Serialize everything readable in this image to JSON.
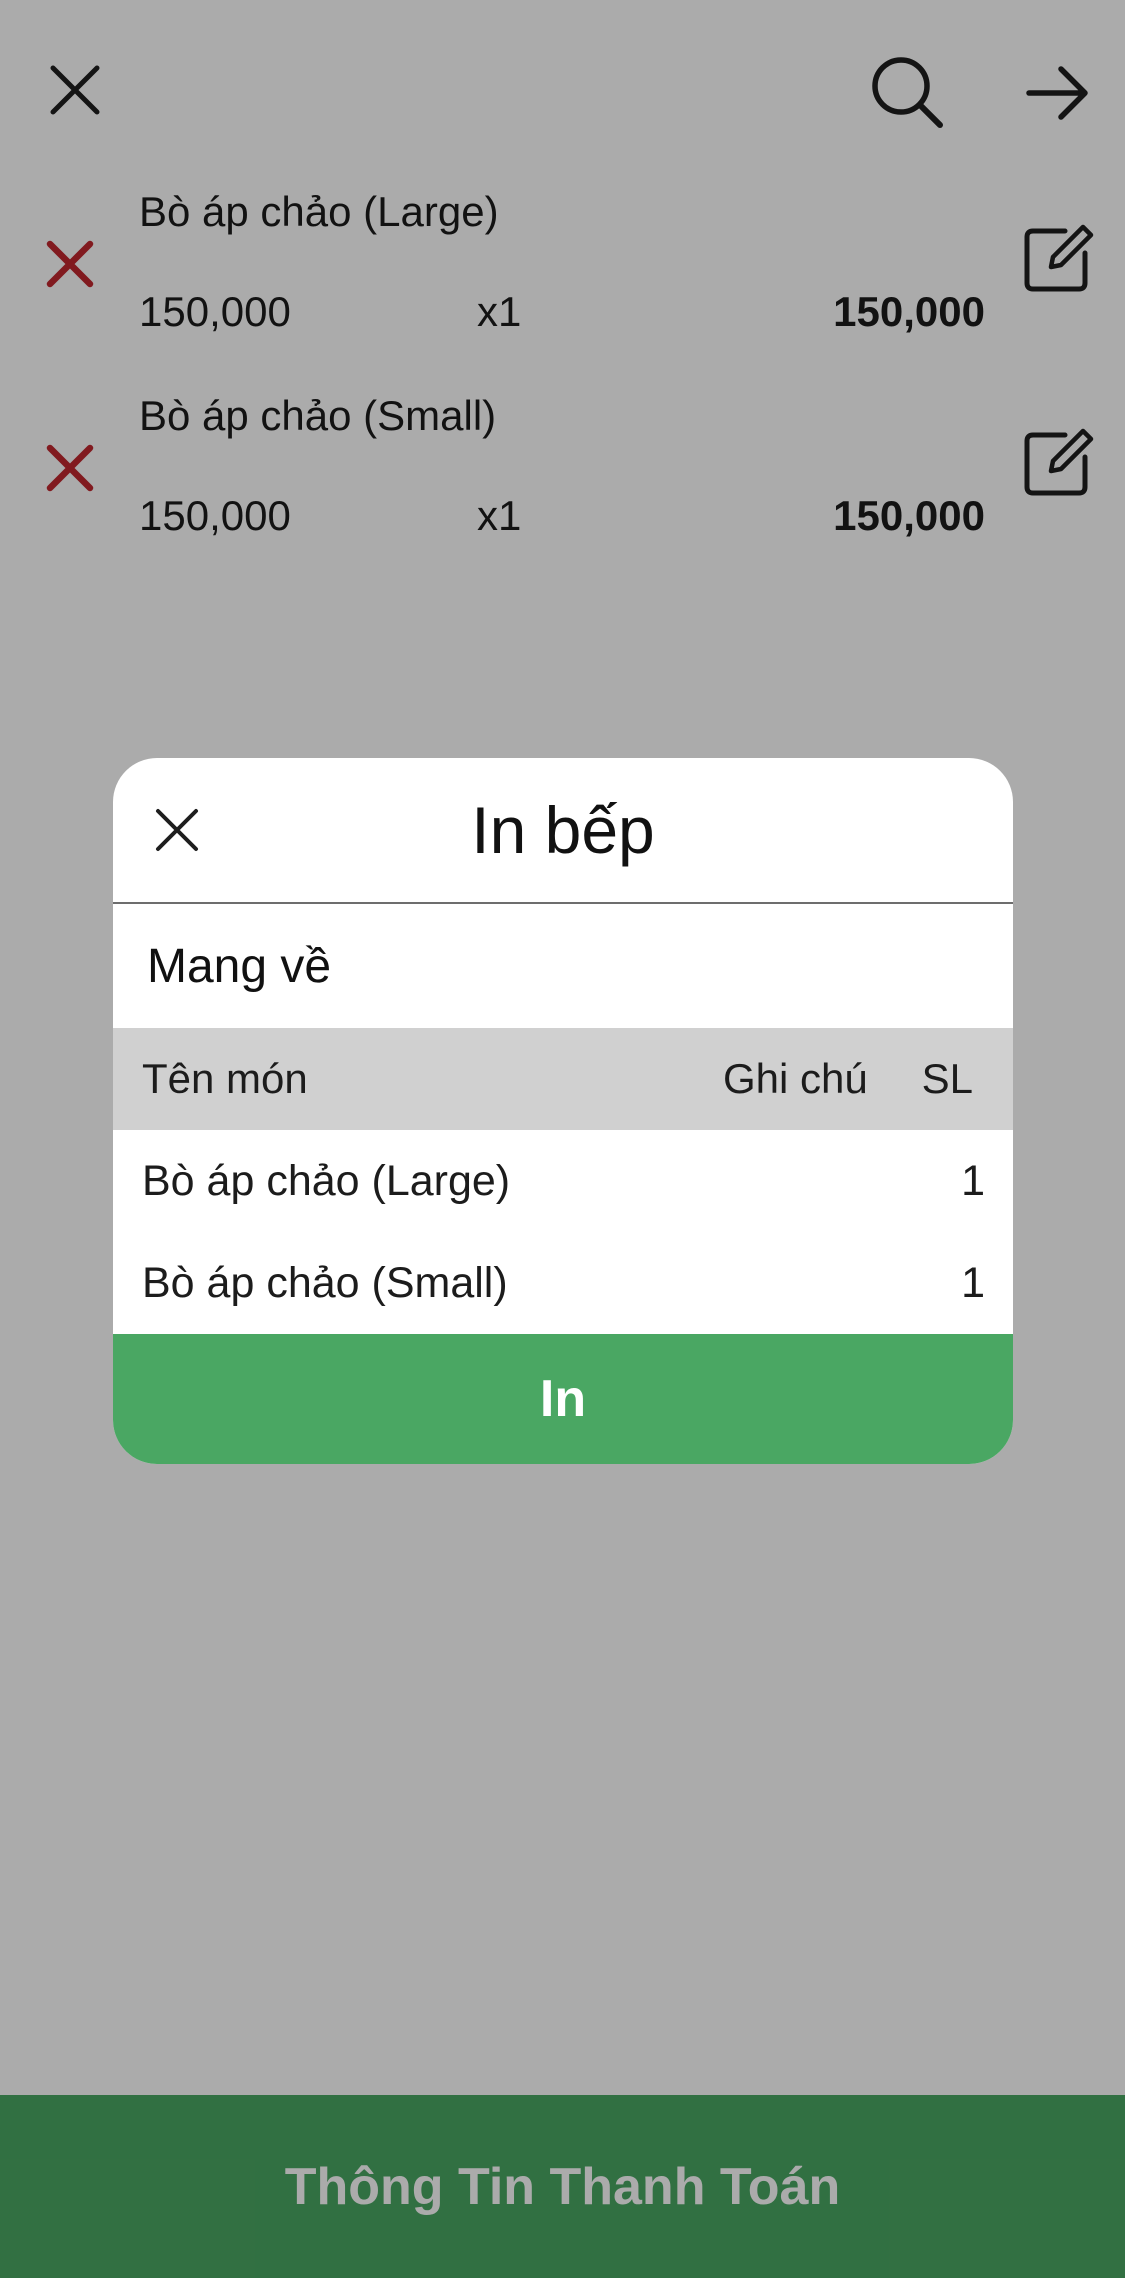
{
  "colors": {
    "accent_green": "#4aa763",
    "delete_red": "#c0272f",
    "overlay": "rgba(0,0,0,0.33)",
    "table_header_bg": "#d0d0d0"
  },
  "topbar": {
    "close_icon": "close-icon",
    "search_icon": "search-icon",
    "next_icon": "arrow-right-icon"
  },
  "order_items": [
    {
      "name": "Bò áp chảo (Large)",
      "unit_price": "150,000",
      "quantity": "x1",
      "total": "150,000"
    },
    {
      "name": "Bò áp chảo (Small)",
      "unit_price": "150,000",
      "quantity": "x1",
      "total": "150,000"
    }
  ],
  "payment_bar": {
    "label": "Thông Tin Thanh Toán"
  },
  "modal": {
    "title": "In bếp",
    "order_type": "Mang về",
    "table": {
      "columns": [
        "Tên món",
        "Ghi chú",
        "SL"
      ],
      "rows": [
        {
          "name": "Bò áp chảo (Large)",
          "note": "",
          "qty": "1"
        },
        {
          "name": "Bò áp chảo (Small)",
          "note": "",
          "qty": "1"
        }
      ]
    },
    "print_label": "In"
  }
}
